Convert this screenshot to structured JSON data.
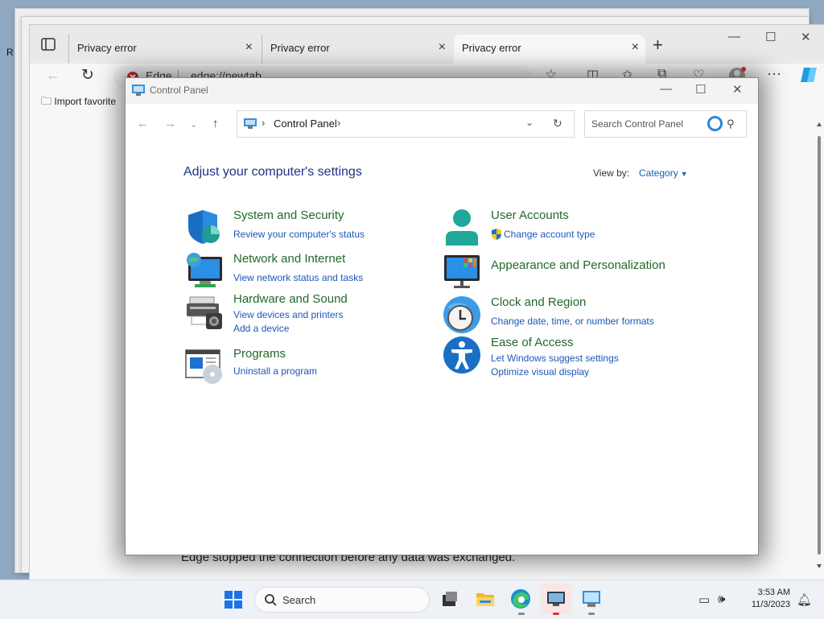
{
  "desktop": {
    "edge_char": "R"
  },
  "browser": {
    "tabs": [
      {
        "label": "Privacy error"
      },
      {
        "label": "Privacy error"
      },
      {
        "label": "Privacy error"
      }
    ],
    "address": {
      "site_label": "Edge",
      "url": "edge://newtab"
    },
    "favorites_bar": {
      "import_label": "Import favorite"
    },
    "page_message": "Edge stopped the connection before any data was exchanged."
  },
  "control_panel": {
    "window_title": "Control Panel",
    "breadcrumb": "Control Panel",
    "search_placeholder": "Search Control Panel",
    "heading": "Adjust your computer's settings",
    "view_by_label": "View by:",
    "view_by_value": "Category",
    "categories": [
      {
        "title": "System and Security",
        "links": [
          "Review your computer's status"
        ]
      },
      {
        "title": "Network and Internet",
        "links": [
          "View network status and tasks"
        ]
      },
      {
        "title": "Hardware and Sound",
        "links": [
          "View devices and printers",
          "Add a device"
        ]
      },
      {
        "title": "Programs",
        "links": [
          "Uninstall a program"
        ]
      },
      {
        "title": "User Accounts",
        "links": [
          "Change account type"
        ]
      },
      {
        "title": "Appearance and Personalization",
        "links": []
      },
      {
        "title": "Clock and Region",
        "links": [
          "Change date, time, or number formats"
        ]
      },
      {
        "title": "Ease of Access",
        "links": [
          "Let Windows suggest settings",
          "Optimize visual display"
        ]
      }
    ]
  },
  "taskbar": {
    "search_label": "Search",
    "time": "3:53 AM",
    "date": "11/3/2023"
  },
  "colors": {
    "heading_blue": "#1e3287",
    "category_green": "#22692b",
    "link_blue": "#1d58b8"
  }
}
